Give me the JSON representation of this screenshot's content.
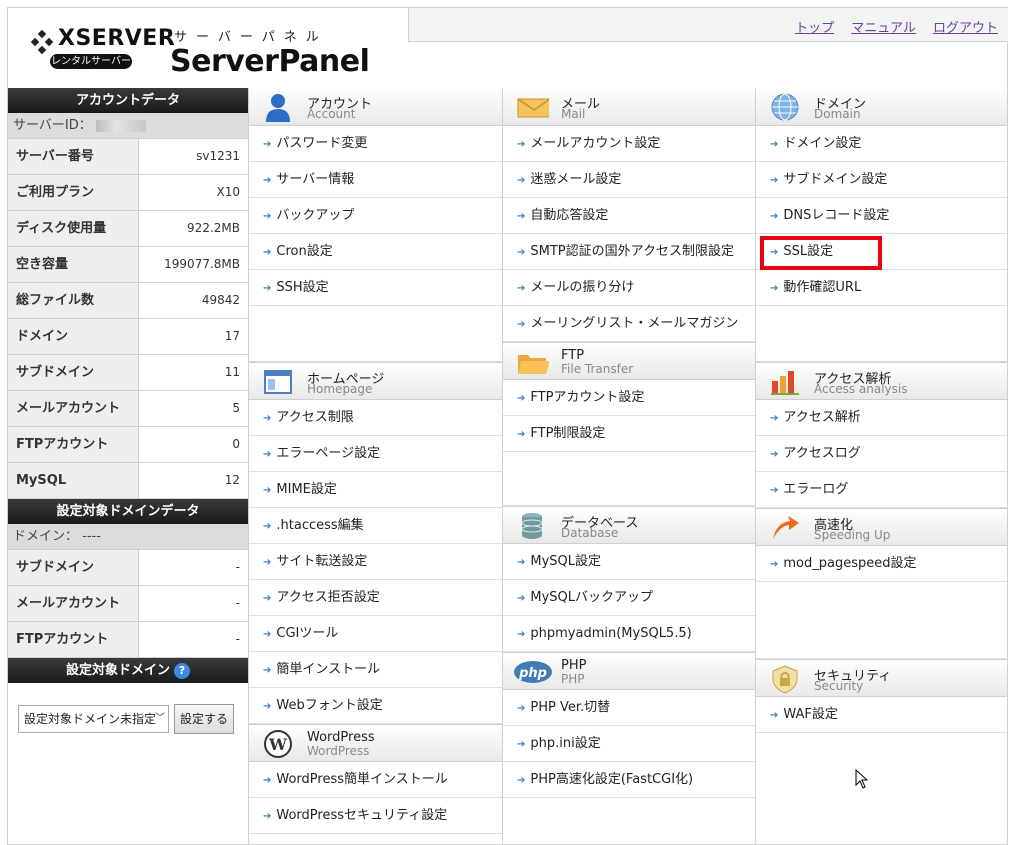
{
  "header": {
    "brand_name": "XSERVER",
    "brand_badge": "レンタルサーバー",
    "panel_kana": "サーバーパネル",
    "panel_title": "ServerPanel",
    "links": [
      "トップ",
      "マニュアル",
      "ログアウト"
    ]
  },
  "account_data": {
    "title": "アカウントデータ",
    "server_id_label": "サーバーID：",
    "rows": [
      {
        "label": "サーバー番号",
        "value": "sv1231"
      },
      {
        "label": "ご利用プラン",
        "value": "X10"
      },
      {
        "label": "ディスク使用量",
        "value": "922.2MB"
      },
      {
        "label": "空き容量",
        "value": "199077.8MB"
      },
      {
        "label": "総ファイル数",
        "value": "49842"
      },
      {
        "label": "ドメイン",
        "value": "17"
      },
      {
        "label": "サブドメイン",
        "value": "11"
      },
      {
        "label": "メールアカウント",
        "value": "5"
      },
      {
        "label": "FTPアカウント",
        "value": "0"
      },
      {
        "label": "MySQL",
        "value": "12"
      }
    ]
  },
  "domain_data": {
    "title": "設定対象ドメインデータ",
    "domain_label": "ドメイン： ----",
    "rows": [
      {
        "label": "サブドメイン",
        "value": "-"
      },
      {
        "label": "メールアカウント",
        "value": "-"
      },
      {
        "label": "FTPアカウント",
        "value": "-"
      }
    ]
  },
  "domain_select": {
    "title": "設定対象ドメイン",
    "help": "?",
    "selected": "設定対象ドメイン未指定",
    "button": "設定する"
  },
  "sections": {
    "account": {
      "title": "アカウント",
      "sub": "Account",
      "items": [
        "パスワード変更",
        "サーバー情報",
        "バックアップ",
        "Cron設定",
        "SSH設定"
      ]
    },
    "mail": {
      "title": "メール",
      "sub": "Mail",
      "items": [
        "メールアカウント設定",
        "迷惑メール設定",
        "自動応答設定",
        "SMTP認証の国外アクセス制限設定",
        "メールの振り分け",
        "メーリングリスト・メールマガジン"
      ]
    },
    "domain": {
      "title": "ドメイン",
      "sub": "Domain",
      "items": [
        "ドメイン設定",
        "サブドメイン設定",
        "DNSレコード設定",
        "SSL設定",
        "動作確認URL"
      ]
    },
    "homepage": {
      "title": "ホームページ",
      "sub": "Homepage",
      "items": [
        "アクセス制限",
        "エラーページ設定",
        "MIME設定",
        ".htaccess編集",
        "サイト転送設定",
        "アクセス拒否設定",
        "CGIツール",
        "簡単インストール",
        "Webフォント設定"
      ]
    },
    "ftp": {
      "title": "FTP",
      "sub": "File Transfer",
      "items": [
        "FTPアカウント設定",
        "FTP制限設定"
      ]
    },
    "analysis": {
      "title": "アクセス解析",
      "sub": "Access analysis",
      "items": [
        "アクセス解析",
        "アクセスログ",
        "エラーログ"
      ]
    },
    "database": {
      "title": "データベース",
      "sub": "Database",
      "items": [
        "MySQL設定",
        "MySQLバックアップ",
        "phpmyadmin(MySQL5.5)"
      ]
    },
    "speed": {
      "title": "高速化",
      "sub": "Speeding Up",
      "items": [
        "mod_pagespeed設定"
      ]
    },
    "php": {
      "title": "PHP",
      "sub": "PHP",
      "items": [
        "PHP Ver.切替",
        "php.ini設定",
        "PHP高速化設定(FastCGI化)"
      ]
    },
    "security": {
      "title": "セキュリティ",
      "sub": "Security",
      "items": [
        "WAF設定"
      ]
    },
    "wordpress": {
      "title": "WordPress",
      "sub": "WordPress",
      "items": [
        "WordPress簡単インストール",
        "WordPressセキュリティ設定"
      ]
    }
  },
  "colors": {
    "highlight": "#e60012",
    "link": "#6b3f9e",
    "arrow": "#3a7fbf"
  }
}
